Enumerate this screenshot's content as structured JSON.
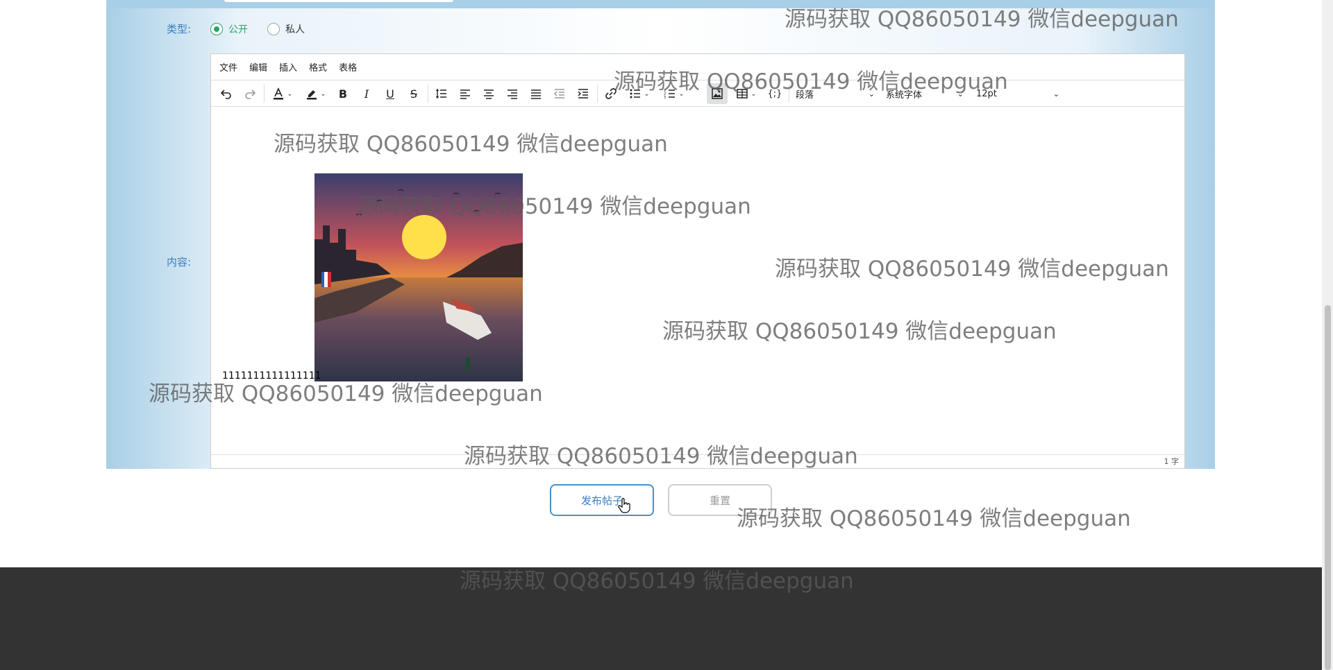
{
  "form": {
    "type_label": "类型:",
    "type_options": [
      "公开",
      "私人"
    ],
    "type_selected": "公开",
    "content_label": "内容:"
  },
  "editor": {
    "menu": [
      "文件",
      "编辑",
      "插入",
      "格式",
      "表格"
    ],
    "block_format": "段落",
    "font_family": "系统字体",
    "font_size": "12pt",
    "body_text": "1111111111111111",
    "word_count": "1 字",
    "icons": [
      "undo-icon",
      "redo-icon",
      "text-color-icon",
      "highlight-icon",
      "bold-icon",
      "italic-icon",
      "underline-icon",
      "strikethrough-icon",
      "line-height-icon",
      "align-left-icon",
      "align-center-icon",
      "align-right-icon",
      "justify-icon",
      "outdent-icon",
      "indent-icon",
      "link-icon",
      "bullet-list-icon",
      "numbered-list-icon",
      "image-icon",
      "table-icon",
      "code-icon"
    ]
  },
  "buttons": {
    "publish": "发布帖子",
    "reset": "重置"
  },
  "watermark": "源码获取 QQ86050149 微信deepguan"
}
